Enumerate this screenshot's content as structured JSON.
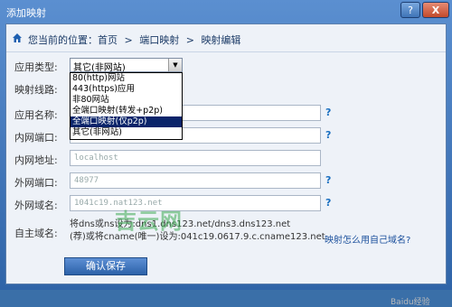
{
  "window": {
    "title": "添加映射",
    "help_label": "?",
    "close_label": "X"
  },
  "breadcrumb": {
    "prefix": "您当前的位置：首页",
    "sep1": ">",
    "item1": "端口映射",
    "sep2": ">",
    "item2": "映射编辑"
  },
  "form": {
    "app_type": {
      "label": "应用类型:",
      "value": "其它(非网站)",
      "options": [
        "80(http)网站",
        "443(https)应用",
        "非80网站",
        "全端口映射(转发+p2p)",
        "全端口映射(仅p2p)",
        "其它(非网站)"
      ],
      "highlighted": "全端口映射(仅p2p)"
    },
    "line": {
      "label": "映射线路:"
    },
    "app_name": {
      "label": "应用名称:"
    },
    "lan_port": {
      "label": "内网端口:"
    },
    "lan_addr": {
      "label": "内网地址:",
      "value": "localhost"
    },
    "wan_port": {
      "label": "外网端口:",
      "value": "48977"
    },
    "wan_domain": {
      "label": "外网域名:",
      "value": "1041c19.nat123.net"
    },
    "custom_domain": {
      "label": "自主域名:",
      "line1": "将dns或ns设为:dns1.dns123.net/dns3.dns123.net",
      "line2": "(荐)或将cname(唯一)设为:041c19.0617.9.c.cname123.net",
      "help_link": "映射怎么用自己域名?"
    }
  },
  "help_mark": "?",
  "save_button": "确认保存",
  "watermark": "吉云网",
  "baidu": "Baidu经验"
}
